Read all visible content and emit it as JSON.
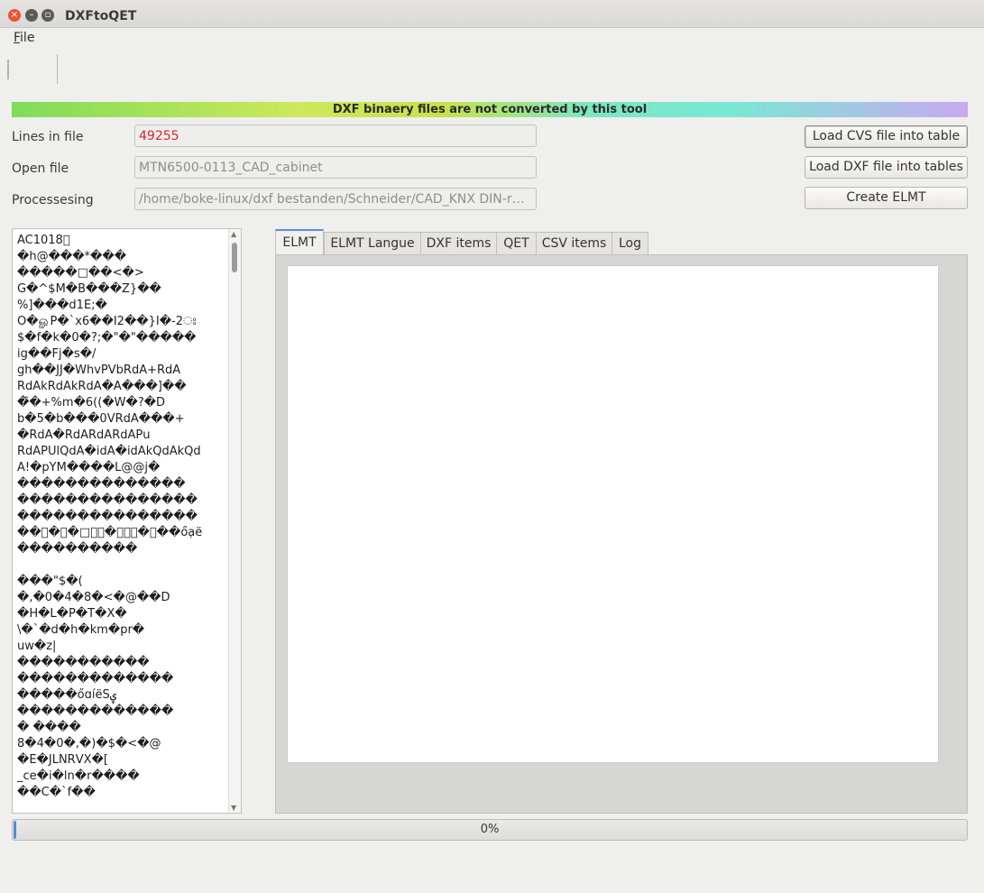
{
  "window": {
    "title": "DXFtoQET"
  },
  "menu": {
    "file_prefix": "F",
    "file_rest": "ile"
  },
  "banner": {
    "text": "DXF binaery files are not converted by this tool"
  },
  "fields": {
    "lines_label": "Lines in file",
    "lines_value": "49255",
    "open_label": "Open file",
    "open_value": "MTN6500-0113_CAD_cabinet",
    "processing_label": "Processesing",
    "processing_value": "/home/boke-linux/dxf bestanden/Schneider/CAD_KNX DIN-rail..."
  },
  "buttons": {
    "load_cvs": "Load CVS file into table",
    "load_dxf": "Load DXF file into tables",
    "create_elmt": "Create ELMT"
  },
  "file_content": [
    "AC1018\u0000",
    "\u0001\u0001\u0003\u0002�h@���*��\u0000�",
    "�����□��<�>",
    "\u0001\u0001G�\u0001\u0001^$M�B���\u0001\u0001Z}��",
    "%\u0001]���d1E;\u0001�",
    "O\u0001�ௐP�`x6��I2��}I�-2ਃ\u0001",
    "$�f�k�0�?;�\"�\"����\u0001�",
    "ig\u0001��Fj\u0001�s\u0001�\u0001/",
    "gh��JJ�WhvPV\u0001bRdA+RdA",
    "RdAkRdAkRdA�A���]��\u0001",
    "�̑�\u0001+\u0001%m\u0001�6((�W�?�D",
    "b�5�b���0V\u0001\u0001RdA���+",
    "�RdA�RdA\u0001RdA\u0001RdA\u0001P\u0001u",
    "RdAPU\u0001lQdA�idA�idAkQdAkQd",
    "A!�pYM�\u0001\u0001���\u0001L\u0001@@j�",
    "\u0001��������������",
    "���������������",
    "���������������",
    "��\u0001�\u0001�□ా\u0001�\u0001\u0001\u0001�\u0001��őạë",
    "�\u0001\u0001\u0001\u0001\u0001\u0001\u0001\u0001����\u0001�\u0001�\u0001���",
    "\u0001",
    "�\u0001\u0001\u0001\u0001\u0001\u0001\u0001\u0001\u0001\u0001�\u0001\u0001�\u0001\u0001\u0001\u0001\"\u0001\u0001$�\u0001(",
    "�\u0001,�\u00010�\u00014�\u00018�\u0001<�\u0001@��\u0001D",
    "�\u0001H�\u0001L�\u0001P�\u0001T�\u0001X�\u0001",
    "\\�\u0001`�\u0001d�\u0001h�\u0001k\u0001\u0001m�\u0001p\u0001\u0001r�\u0001",
    "u\u0001\u0001w�\u0001z\u0001\u0001|",
    "�\u0001\u0001\u0001\u0001��\u0001�\u0001\u0001��\u0001��\u0001���\u0001",
    "��\u0001��\u0001��\u0001��\u0001��\u0001��\u0001�",
    "��\u0001��\u0001�\u0001ő\u0001ɑí\u0001ë\u0001S\u0001ۑ\u0001\u0001",
    "��\u0001��\u0001��\u0001��\u0001��\u0001���",
    "\u0001� \u0001��\u0001��",
    "8\u0001�4\u0001�0\u0001�,\u0001�)\u0001�$�\u0001<�\u0001@",
    "�\u0001E�\u0001J\u0001\u0001L\u0001\u0001N\u0001\u0001R\u0001\u0001V\u0001\u0001X�\u0001[\u0001\u0001",
    "_\u0001\u0001c\u0001\u0001e�\u0001i�\u0001l\u0001\u0001n�\u0001r����",
    "��C\u0001\u0001�\u0001`f\u0001��"
  ],
  "tabs": [
    {
      "label": "ELMT",
      "active": true
    },
    {
      "label": "ELMT Langue",
      "active": false
    },
    {
      "label": "DXF items",
      "active": false
    },
    {
      "label": "QET",
      "active": false
    },
    {
      "label": "CSV items",
      "active": false
    },
    {
      "label": "Log",
      "active": false
    }
  ],
  "progress": {
    "value": 0,
    "label": "0%"
  },
  "colors": {
    "accent": "#4a90d9",
    "lines_value": "#d8262a"
  }
}
